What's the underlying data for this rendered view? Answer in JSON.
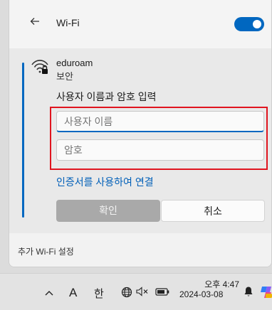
{
  "header": {
    "title": "Wi-Fi",
    "wifi_enabled": true
  },
  "network": {
    "name": "eduroam",
    "status": "보안",
    "prompt": "사용자 이름과 암호 입력",
    "username_placeholder": "사용자 이름",
    "password_placeholder": "암호",
    "cert_link": "인증서를 사용하여 연결",
    "ok_label": "확인",
    "cancel_label": "취소"
  },
  "footer": {
    "more_settings": "추가 Wi-Fi 설정"
  },
  "taskbar": {
    "ime_mode": "A",
    "ime_lang": "한",
    "time": "오후 4:47",
    "date": "2024-03-08"
  },
  "colors": {
    "accent": "#0067c0",
    "highlight": "#e0141e"
  }
}
